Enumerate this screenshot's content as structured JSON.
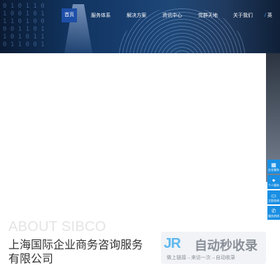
{
  "nav": {
    "items": [
      {
        "label": "首页",
        "active": true
      },
      {
        "label": "服务体系"
      },
      {
        "label": "解决方案"
      },
      {
        "label": "资讯中心"
      },
      {
        "label": "党群天地"
      },
      {
        "label": "关于我们"
      }
    ],
    "lang": {
      "primary": "/",
      "secondary": "英"
    }
  },
  "side_dock": [
    {
      "label": "企业服务",
      "icon": "building-icon"
    },
    {
      "label": "个人服务",
      "icon": "person-icon"
    },
    {
      "label": "立即咨询",
      "icon": "chat-icon"
    },
    {
      "label": "服务热线",
      "icon": "phone-icon"
    }
  ],
  "about": {
    "title": "ABOUT SIBCO",
    "company": "上海国际企业商务咨询服务有限公司"
  },
  "watermark": {
    "logo": "JR",
    "main": "自动秒收录",
    "sub": "做上链接→来访一次→自动收录"
  },
  "colors": {
    "accent": "#1a8fe3",
    "nav_active": "#1e4fa8",
    "hero_dark": "#0a1a33"
  }
}
